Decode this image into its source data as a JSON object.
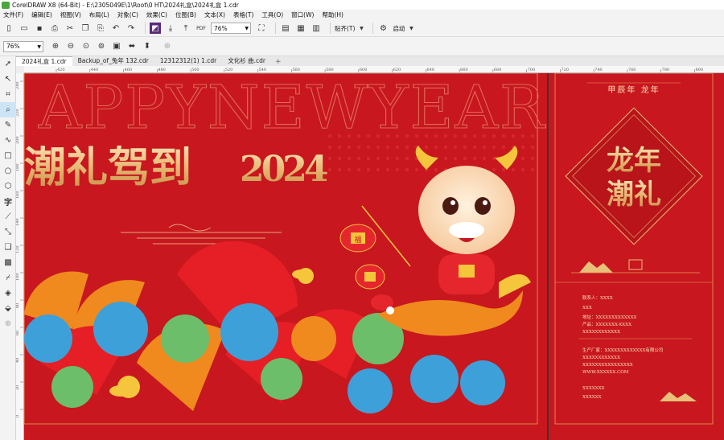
{
  "window": {
    "title": "CorelDRAW X8 (64-Bit) - E:\\2305049E\\1\\Root\\0 HT\\2024礼盒\\2024礼盒 1.cdr"
  },
  "menu": [
    "文件(F)",
    "编辑(E)",
    "视图(V)",
    "布局(L)",
    "对象(C)",
    "效果(C)",
    "位图(B)",
    "文本(X)",
    "表格(T)",
    "工具(O)",
    "窗口(W)",
    "帮助(H)"
  ],
  "toolbar": {
    "zoom_value": "76%",
    "snap_label": "贴齐(T)",
    "launch_label": "启动",
    "pdf_label": "PDF"
  },
  "propbar": {
    "zoom_value": "76%"
  },
  "tabs": [
    {
      "label": "2024礼盒 1.cdr",
      "active": true
    },
    {
      "label": "Backup_of_兔年 132.cdr",
      "active": false
    },
    {
      "label": "12312312(1) 1.cdr",
      "active": false
    },
    {
      "label": "文化衫 曲.cdr",
      "active": false
    }
  ],
  "ruler": {
    "h_ticks": [
      "420",
      "440",
      "460",
      "480",
      "500",
      "520",
      "540",
      "560",
      "580",
      "600",
      "620",
      "640",
      "660",
      "680",
      "700",
      "720",
      "740",
      "760",
      "780",
      "800",
      "820",
      "840",
      "860",
      "880",
      "900"
    ],
    "v_ticks": [
      "240",
      "220",
      "200",
      "180",
      "160",
      "140",
      "120",
      "100",
      "80",
      "60",
      "40",
      "20",
      "0"
    ]
  },
  "artwork": {
    "bg_text": "APPYNEWYEAR",
    "headline": "潮礼驾到",
    "year_digits": "2024",
    "badge_tl": "龙年",
    "badge_tl2": "潮礼",
    "right_header": "甲辰年   龙年",
    "lantern_char": "福",
    "info_lines": [
      "联系人：XXXX",
      "XXX",
      "地址：XXXXXXXXXXXXX",
      "产品：XXXXXXX-XXXX",
      "XXXXXXXXXXXX",
      "生产厂家：XXXXXXXXXXXXX有限公司",
      "XXXXXXXXXXXX",
      "XXXXXXXXXXXXXXXX",
      "WWW.XXXXXX.COM",
      "XXXXXXX",
      "XXXXXX"
    ],
    "colors": {
      "primary_red": "#c8171e",
      "dark_red": "#9e0f14",
      "gold": "#e8c07a",
      "orange": "#f08a1e",
      "blue": "#3ea0d8",
      "green": "#6dbe6a"
    }
  }
}
